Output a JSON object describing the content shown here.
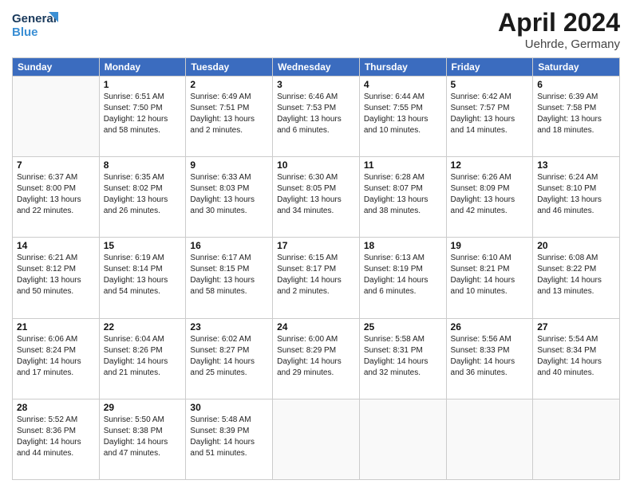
{
  "header": {
    "logo_line1": "General",
    "logo_line2": "Blue",
    "month": "April 2024",
    "location": "Uehrde, Germany"
  },
  "weekdays": [
    "Sunday",
    "Monday",
    "Tuesday",
    "Wednesday",
    "Thursday",
    "Friday",
    "Saturday"
  ],
  "weeks": [
    [
      {
        "day": "",
        "info": ""
      },
      {
        "day": "1",
        "info": "Sunrise: 6:51 AM\nSunset: 7:50 PM\nDaylight: 12 hours\nand 58 minutes."
      },
      {
        "day": "2",
        "info": "Sunrise: 6:49 AM\nSunset: 7:51 PM\nDaylight: 13 hours\nand 2 minutes."
      },
      {
        "day": "3",
        "info": "Sunrise: 6:46 AM\nSunset: 7:53 PM\nDaylight: 13 hours\nand 6 minutes."
      },
      {
        "day": "4",
        "info": "Sunrise: 6:44 AM\nSunset: 7:55 PM\nDaylight: 13 hours\nand 10 minutes."
      },
      {
        "day": "5",
        "info": "Sunrise: 6:42 AM\nSunset: 7:57 PM\nDaylight: 13 hours\nand 14 minutes."
      },
      {
        "day": "6",
        "info": "Sunrise: 6:39 AM\nSunset: 7:58 PM\nDaylight: 13 hours\nand 18 minutes."
      }
    ],
    [
      {
        "day": "7",
        "info": "Sunrise: 6:37 AM\nSunset: 8:00 PM\nDaylight: 13 hours\nand 22 minutes."
      },
      {
        "day": "8",
        "info": "Sunrise: 6:35 AM\nSunset: 8:02 PM\nDaylight: 13 hours\nand 26 minutes."
      },
      {
        "day": "9",
        "info": "Sunrise: 6:33 AM\nSunset: 8:03 PM\nDaylight: 13 hours\nand 30 minutes."
      },
      {
        "day": "10",
        "info": "Sunrise: 6:30 AM\nSunset: 8:05 PM\nDaylight: 13 hours\nand 34 minutes."
      },
      {
        "day": "11",
        "info": "Sunrise: 6:28 AM\nSunset: 8:07 PM\nDaylight: 13 hours\nand 38 minutes."
      },
      {
        "day": "12",
        "info": "Sunrise: 6:26 AM\nSunset: 8:09 PM\nDaylight: 13 hours\nand 42 minutes."
      },
      {
        "day": "13",
        "info": "Sunrise: 6:24 AM\nSunset: 8:10 PM\nDaylight: 13 hours\nand 46 minutes."
      }
    ],
    [
      {
        "day": "14",
        "info": "Sunrise: 6:21 AM\nSunset: 8:12 PM\nDaylight: 13 hours\nand 50 minutes."
      },
      {
        "day": "15",
        "info": "Sunrise: 6:19 AM\nSunset: 8:14 PM\nDaylight: 13 hours\nand 54 minutes."
      },
      {
        "day": "16",
        "info": "Sunrise: 6:17 AM\nSunset: 8:15 PM\nDaylight: 13 hours\nand 58 minutes."
      },
      {
        "day": "17",
        "info": "Sunrise: 6:15 AM\nSunset: 8:17 PM\nDaylight: 14 hours\nand 2 minutes."
      },
      {
        "day": "18",
        "info": "Sunrise: 6:13 AM\nSunset: 8:19 PM\nDaylight: 14 hours\nand 6 minutes."
      },
      {
        "day": "19",
        "info": "Sunrise: 6:10 AM\nSunset: 8:21 PM\nDaylight: 14 hours\nand 10 minutes."
      },
      {
        "day": "20",
        "info": "Sunrise: 6:08 AM\nSunset: 8:22 PM\nDaylight: 14 hours\nand 13 minutes."
      }
    ],
    [
      {
        "day": "21",
        "info": "Sunrise: 6:06 AM\nSunset: 8:24 PM\nDaylight: 14 hours\nand 17 minutes."
      },
      {
        "day": "22",
        "info": "Sunrise: 6:04 AM\nSunset: 8:26 PM\nDaylight: 14 hours\nand 21 minutes."
      },
      {
        "day": "23",
        "info": "Sunrise: 6:02 AM\nSunset: 8:27 PM\nDaylight: 14 hours\nand 25 minutes."
      },
      {
        "day": "24",
        "info": "Sunrise: 6:00 AM\nSunset: 8:29 PM\nDaylight: 14 hours\nand 29 minutes."
      },
      {
        "day": "25",
        "info": "Sunrise: 5:58 AM\nSunset: 8:31 PM\nDaylight: 14 hours\nand 32 minutes."
      },
      {
        "day": "26",
        "info": "Sunrise: 5:56 AM\nSunset: 8:33 PM\nDaylight: 14 hours\nand 36 minutes."
      },
      {
        "day": "27",
        "info": "Sunrise: 5:54 AM\nSunset: 8:34 PM\nDaylight: 14 hours\nand 40 minutes."
      }
    ],
    [
      {
        "day": "28",
        "info": "Sunrise: 5:52 AM\nSunset: 8:36 PM\nDaylight: 14 hours\nand 44 minutes."
      },
      {
        "day": "29",
        "info": "Sunrise: 5:50 AM\nSunset: 8:38 PM\nDaylight: 14 hours\nand 47 minutes."
      },
      {
        "day": "30",
        "info": "Sunrise: 5:48 AM\nSunset: 8:39 PM\nDaylight: 14 hours\nand 51 minutes."
      },
      {
        "day": "",
        "info": ""
      },
      {
        "day": "",
        "info": ""
      },
      {
        "day": "",
        "info": ""
      },
      {
        "day": "",
        "info": ""
      }
    ]
  ]
}
